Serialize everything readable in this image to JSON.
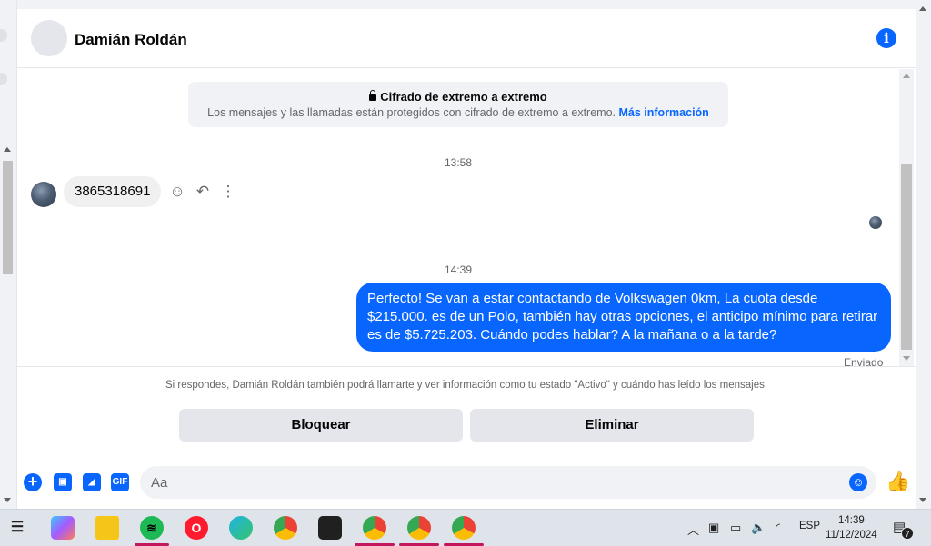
{
  "header": {
    "contact_name": "Damián Roldán"
  },
  "encryption": {
    "title": "Cifrado de extremo a extremo",
    "description": "Los mensajes y las llamadas están protegidos con cifrado de extremo a extremo.",
    "link": "Más información"
  },
  "messages": {
    "timestamp_1": "13:58",
    "incoming_text": "3865318691",
    "timestamp_2": "14:39",
    "outgoing_text": "Perfecto!  Se van a estar contactando de Volkswagen 0km, La cuota desde $215.000. es de un Polo, también hay otras opciones, el anticipo mínimo para retirar es de $5.725.203. Cuándo podes hablar? A la mañana o a la tarde?",
    "status": "Enviado"
  },
  "request": {
    "notice": "Si respondes, Damián Roldán también podrá llamarte y ver información como tu estado \"Activo\" y cuándo has leído los mensajes.",
    "block_label": "Bloquear",
    "delete_label": "Eliminar"
  },
  "composer": {
    "placeholder": "Aa",
    "gif_label": "GIF"
  },
  "taskbar": {
    "language": "ESP",
    "time": "14:39",
    "date": "11/12/2024",
    "notification_count": "7"
  },
  "colors": {
    "accent": "#0866ff",
    "outgoing_bubble": "#0866ff",
    "incoming_bubble": "#f0f0f0"
  }
}
